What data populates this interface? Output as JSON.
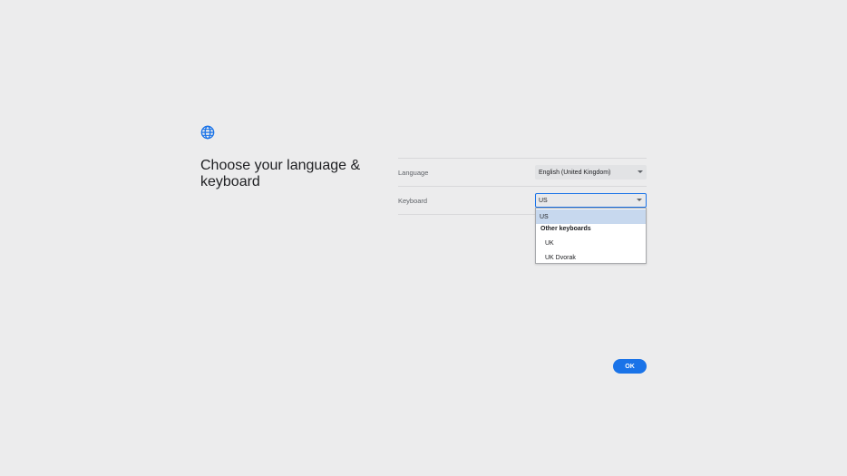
{
  "title": "Choose your language & keyboard",
  "icon": "globe-icon",
  "accent_color": "#1a73e8",
  "language": {
    "label": "Language",
    "value": "English (United Kingdom)"
  },
  "keyboard": {
    "label": "Keyboard",
    "value": "US",
    "dropdown": {
      "selected_option": "US",
      "group_label": "Other keyboards",
      "options": [
        "UK",
        "UK Dvorak"
      ]
    }
  },
  "ok_label": "OK"
}
